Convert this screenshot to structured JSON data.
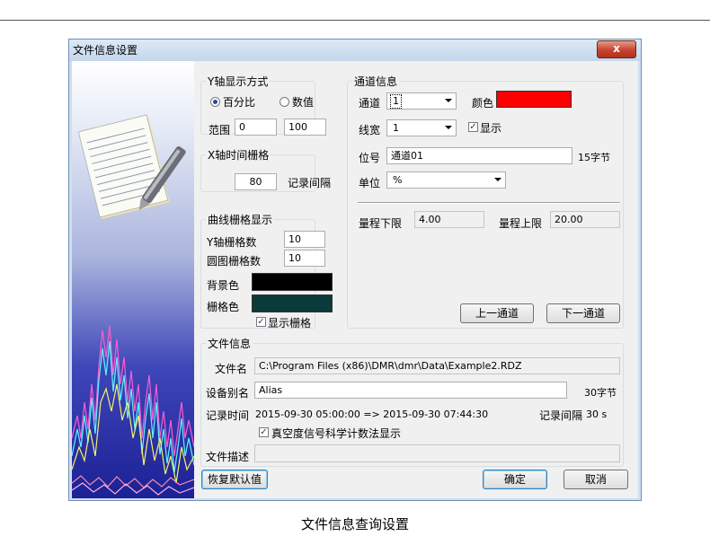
{
  "dialog": {
    "title": "文件信息设置",
    "close_label": "x"
  },
  "y_axis": {
    "group_title": "Y轴显示方式",
    "option_percent": "百分比",
    "option_value": "数值",
    "selected": "百分比",
    "range_label": "范围",
    "range_min": "0",
    "range_max": "100"
  },
  "x_grid": {
    "group_title": "X轴时间栅格",
    "value": "80",
    "unit_label": "记录间隔"
  },
  "curve_grid": {
    "group_title": "曲线栅格显示",
    "y_grid_label": "Y轴栅格数",
    "y_grid_value": "10",
    "circle_grid_label": "圆图栅格数",
    "circle_grid_value": "10",
    "bg_color_label": "背景色",
    "bg_color": "#000000",
    "grid_color_label": "栅格色",
    "grid_color": "#0a3a3a",
    "show_grid_label": "显示栅格",
    "show_grid_checked": true
  },
  "channel": {
    "group_title": "通道信息",
    "channel_label": "通道",
    "channel_value": "1",
    "color_label": "颜色",
    "color": "#ff0000",
    "line_width_label": "线宽",
    "line_width_value": "1",
    "display_label": "显示",
    "display_checked": true,
    "tag_label": "位号",
    "tag_value": "通道01",
    "tag_limit": "15字节",
    "unit_label": "单位",
    "unit_value": "%",
    "range_low_label": "量程下限",
    "range_low_value": "4.00",
    "range_high_label": "量程上限",
    "range_high_value": "20.00",
    "prev_button": "上一通道",
    "next_button": "下一通道"
  },
  "file_info": {
    "group_title": "文件信息",
    "filename_label": "文件名",
    "filename_value": "C:\\Program Files (x86)\\DMR\\dmr\\Data\\Example2.RDZ",
    "alias_label": "设备别名",
    "alias_value": "Alias",
    "alias_limit": "30字节",
    "record_time_label": "记录时间",
    "record_time_value": "2015-09-30 05:00:00 => 2015-09-30 07:44:30",
    "record_interval_label": "记录间隔",
    "record_interval_value": "30 s",
    "vacuum_label": "真空度信号科学计数法显示",
    "vacuum_checked": true,
    "desc_label": "文件描述",
    "desc_value": ""
  },
  "footer": {
    "restore_button": "恢复默认值",
    "ok_button": "确定",
    "cancel_button": "取消"
  },
  "caption": "文件信息查询设置",
  "icons": {
    "sidebar_graphic": "notepad-pen-icon",
    "waveform": "waveform-graphic"
  }
}
